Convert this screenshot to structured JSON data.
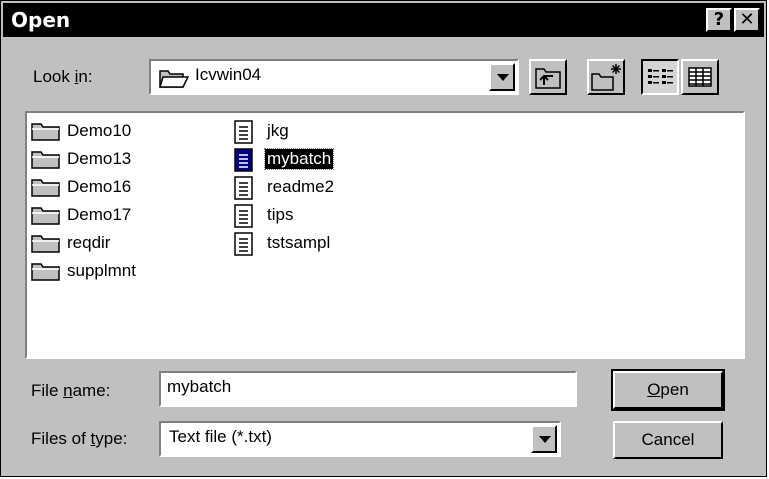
{
  "dialog": {
    "title": "Open",
    "help_button": "?",
    "close_button": "✕"
  },
  "look_in": {
    "label_prefix": "Look ",
    "label_accel": "i",
    "label_suffix": "n:",
    "value": "Icvwin04"
  },
  "toolbar": {
    "buttons": [
      {
        "name": "up-one-level-icon"
      },
      {
        "name": "create-new-folder-icon"
      },
      {
        "name": "list-view-icon",
        "pressed": true
      },
      {
        "name": "details-view-icon"
      }
    ]
  },
  "files": {
    "folders": [
      "Demo10",
      "Demo13",
      "Demo16",
      "Demo17",
      "reqdir",
      "supplmnt"
    ],
    "documents": [
      "jkg",
      "mybatch",
      "readme2",
      "tips",
      "tstsampl"
    ],
    "selected": "mybatch"
  },
  "file_name": {
    "label_prefix": "File ",
    "label_accel": "n",
    "label_suffix": "ame:",
    "value": "mybatch"
  },
  "file_type": {
    "label_prefix": "Files of ",
    "label_accel": "t",
    "label_suffix": "ype:",
    "value": "Text file (*.txt)"
  },
  "buttons": {
    "open_accel": "O",
    "open_rest": "pen",
    "cancel": "Cancel"
  }
}
